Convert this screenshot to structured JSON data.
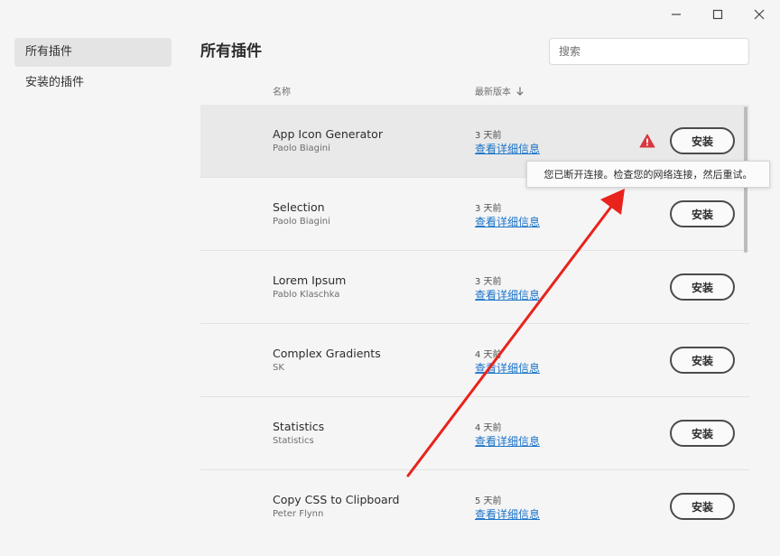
{
  "window": {
    "minimize_icon": "minimize-icon",
    "maximize_icon": "maximize-icon",
    "close_icon": "close-icon"
  },
  "sidebar": {
    "items": [
      {
        "label": "所有插件",
        "active": true
      },
      {
        "label": "安装的插件",
        "active": false
      }
    ]
  },
  "main": {
    "title": "所有插件",
    "search": {
      "placeholder": "搜索",
      "value": ""
    },
    "columns": {
      "name": "名称",
      "version": "最新版本",
      "sort_icon": "arrow-down-icon"
    },
    "details_label": "查看详细信息",
    "install_label": "安装",
    "plugins": [
      {
        "name": "App Icon Generator",
        "author": "Paolo Biagini",
        "date": "3 天前",
        "warning": true
      },
      {
        "name": "Selection",
        "author": "Paolo Biagini",
        "date": "3 天前"
      },
      {
        "name": "Lorem Ipsum",
        "author": "Pablo Klaschka",
        "date": "3 天前"
      },
      {
        "name": "Complex Gradients",
        "author": "SK",
        "date": "4 天前"
      },
      {
        "name": "Statistics",
        "author": "Statistics",
        "date": "4 天前"
      },
      {
        "name": "Copy CSS to Clipboard",
        "author": "Peter Flynn",
        "date": "5 天前"
      }
    ]
  },
  "tooltip": {
    "text": "您已断开连接。检查您的网络连接，然后重试。"
  },
  "colors": {
    "link": "#1a73c8",
    "warning": "#d7373f",
    "annotation_arrow": "#e8231c"
  }
}
